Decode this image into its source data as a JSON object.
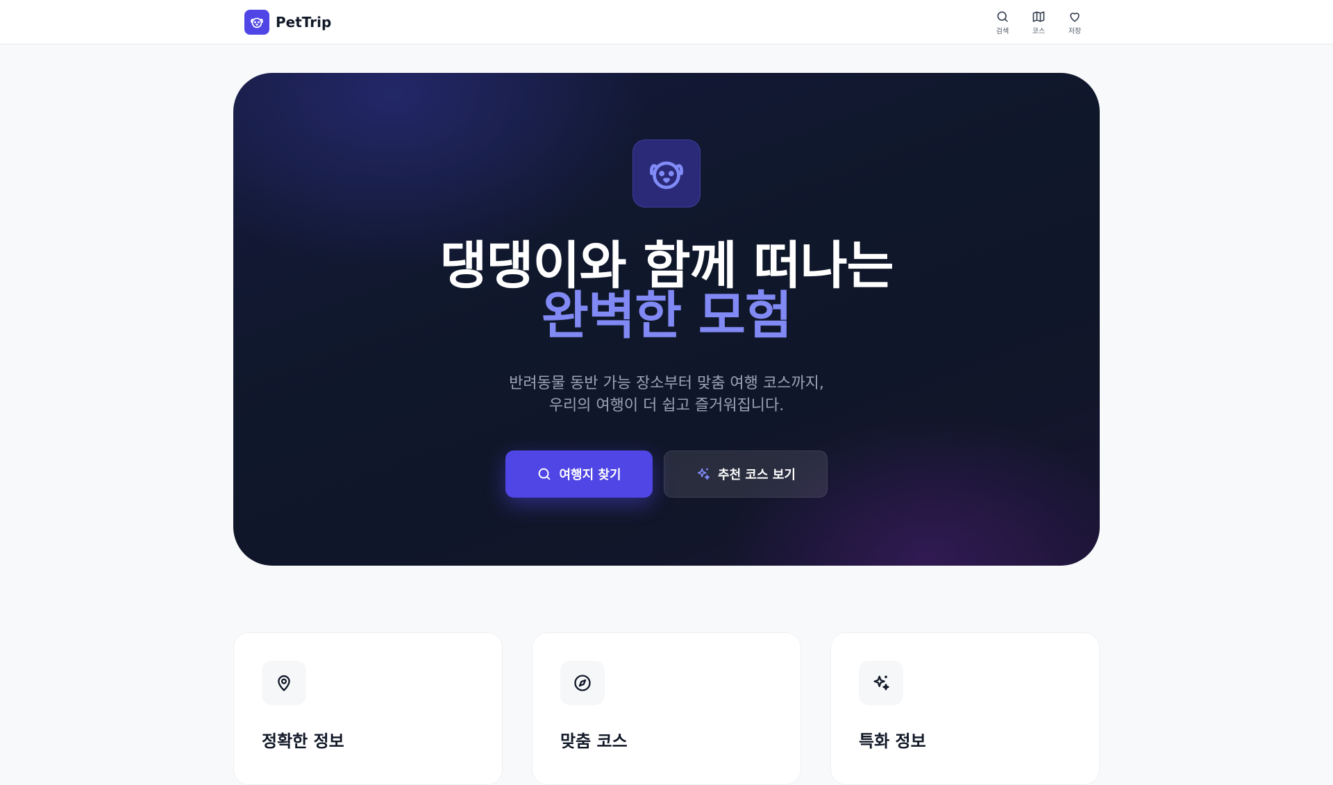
{
  "header": {
    "brand": "PetTrip",
    "nav": [
      {
        "label": "검색",
        "icon": "search-icon"
      },
      {
        "label": "코스",
        "icon": "map-icon"
      },
      {
        "label": "저장",
        "icon": "heart-icon"
      }
    ]
  },
  "hero": {
    "icon": "dog-face-icon",
    "title_line1": "댕댕이와 함께 떠나는",
    "title_line2": "완벽한 모험",
    "subtitle_line1": "반려동물 동반 가능 장소부터 맞춤 여행 코스까지,",
    "subtitle_line2": "우리의 여행이 더 쉽고 즐거워집니다.",
    "primary_button": "여행지 찾기",
    "secondary_button": "추천 코스 보기"
  },
  "features": [
    {
      "title": "정확한 정보",
      "icon": "map-pin-icon"
    },
    {
      "title": "맞춤 코스",
      "icon": "compass-icon"
    },
    {
      "title": "특화 정보",
      "icon": "sparkles-icon"
    }
  ],
  "colors": {
    "accent": "#4f46e5",
    "accent_light": "#8189f4",
    "hero_bg": "#0f172a",
    "page_bg": "#f8f9fb"
  }
}
